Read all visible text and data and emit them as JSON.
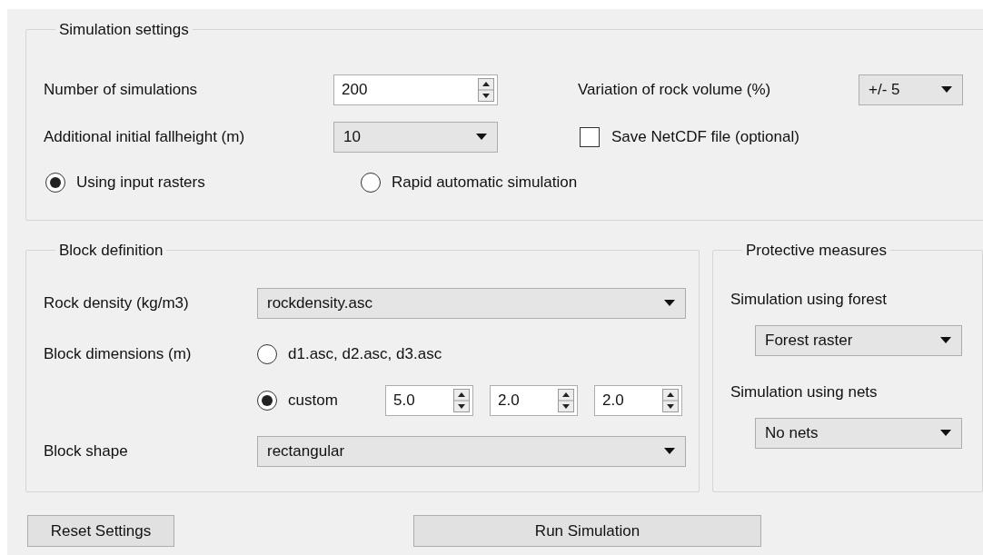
{
  "simulation_settings": {
    "title": "Simulation settings",
    "number_of_simulations": {
      "label": "Number of simulations",
      "value": "200"
    },
    "rock_volume_variation": {
      "label": "Variation of rock volume (%)",
      "value": "+/- 5"
    },
    "initial_fallheight": {
      "label": "Additional initial fallheight (m)",
      "value": "10"
    },
    "save_netcdf": {
      "label": "Save NetCDF file (optional)",
      "checked": false
    },
    "mode_options": [
      {
        "label": "Using input rasters",
        "selected": true
      },
      {
        "label": "Rapid automatic simulation",
        "selected": false
      }
    ]
  },
  "block_definition": {
    "title": "Block definition",
    "rock_density": {
      "label": "Rock density (kg/m3)",
      "value": "rockdensity.asc"
    },
    "block_dimensions": {
      "label": "Block dimensions (m)",
      "options": [
        {
          "label": "d1.asc, d2.asc, d3.asc",
          "selected": false
        },
        {
          "label": "custom",
          "selected": true,
          "values": [
            "5.0",
            "2.0",
            "2.0"
          ]
        }
      ]
    },
    "block_shape": {
      "label": "Block shape",
      "value": "rectangular"
    }
  },
  "protective_measures": {
    "title": "Protective measures",
    "forest": {
      "label": "Simulation using forest",
      "value": "Forest raster"
    },
    "nets": {
      "label": "Simulation using nets",
      "value": "No nets"
    }
  },
  "buttons": [
    {
      "label": "Reset Settings",
      "kind": "reset"
    },
    {
      "label": "Run Simulation",
      "kind": "run"
    }
  ]
}
